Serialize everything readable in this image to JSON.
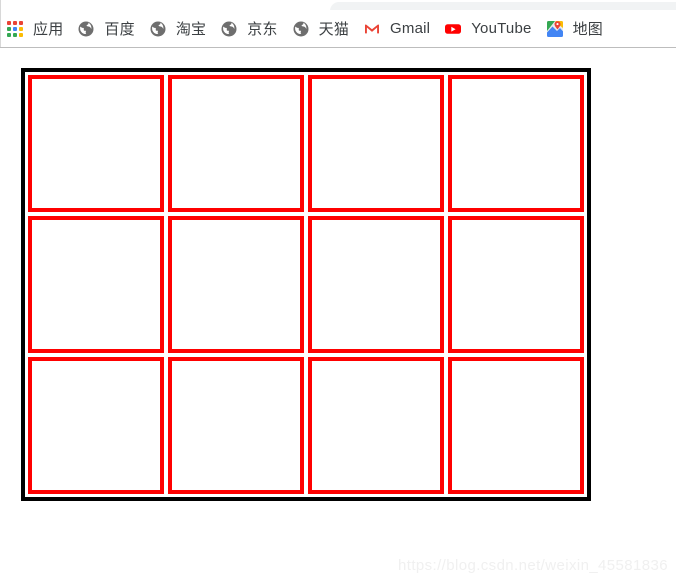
{
  "browser": {
    "bookmarks": [
      {
        "label": "应用",
        "icon": "apps-grid-icon",
        "name": "bookmark-apps"
      },
      {
        "label": "百度",
        "icon": "globe-icon",
        "name": "bookmark-baidu"
      },
      {
        "label": "淘宝",
        "icon": "globe-icon",
        "name": "bookmark-taobao"
      },
      {
        "label": "京东",
        "icon": "globe-icon",
        "name": "bookmark-jd"
      },
      {
        "label": "天猫",
        "icon": "globe-icon",
        "name": "bookmark-tmall"
      },
      {
        "label": "Gmail",
        "icon": "gmail-icon",
        "name": "bookmark-gmail"
      },
      {
        "label": "YouTube",
        "icon": "youtube-icon",
        "name": "bookmark-youtube"
      },
      {
        "label": "地图",
        "icon": "maps-icon",
        "name": "bookmark-maps"
      }
    ]
  },
  "apps_icon_colors": [
    "#ea4335",
    "#ea4335",
    "#ea4335",
    "#34a853",
    "#4285f4",
    "#fbbc05",
    "#34a853",
    "#34a853",
    "#fbbc05"
  ],
  "page_content": {
    "table": {
      "rows": 3,
      "columns": 4,
      "outer_border_color": "#000000",
      "cell_border_color": "#ff0000",
      "cells": [
        [
          "",
          "",
          "",
          ""
        ],
        [
          "",
          "",
          "",
          ""
        ],
        [
          "",
          "",
          "",
          ""
        ]
      ]
    },
    "watermark": "https://blog.csdn.net/weixin_45581836"
  }
}
